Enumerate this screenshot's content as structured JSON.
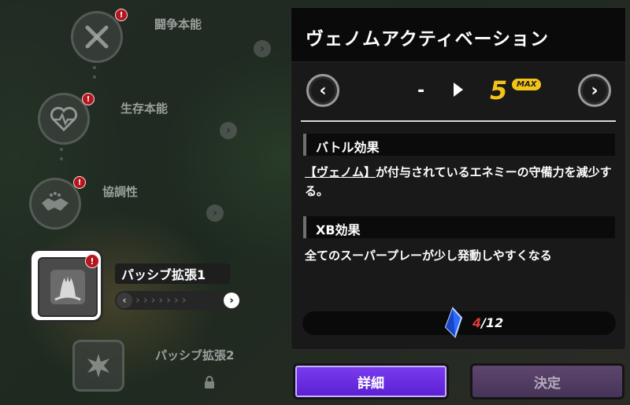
{
  "skill_tree": {
    "nodes": [
      {
        "label": "闘争本能",
        "icon": "crossed-swords-icon",
        "alert": "!"
      },
      {
        "label": "生存本能",
        "icon": "heart-pulse-icon",
        "alert": "!"
      },
      {
        "label": "協調性",
        "icon": "handshake-icon",
        "alert": "!"
      },
      {
        "label": "パッシブ拡張2",
        "icon": "burst-icon"
      }
    ],
    "selected": {
      "label": "パッシブ拡張1",
      "icon": "venom-claw-icon",
      "alert": "!",
      "progress": 0
    }
  },
  "panel": {
    "title": "ヴェノムアクティベーション",
    "level": {
      "current": "-",
      "next": "5",
      "max_badge": "MAX"
    },
    "battle_effect": {
      "heading": "バトル効果",
      "text_prefix": "【ヴェノム】",
      "text_rest": "が付与されているエネミーの守備力を減少する。"
    },
    "xb_effect": {
      "heading": "XB効果",
      "text": "全てのスーパープレーが少し発動しやすくなる"
    },
    "cost": {
      "icon": "blue-crystal-icon",
      "have": "4",
      "need": "/12",
      "accent_color": "#e23a3a"
    }
  },
  "buttons": {
    "detail": "詳細",
    "decide": "決定"
  },
  "colors": {
    "level_accent": "#f2c418",
    "detail_button": "#6a2ee8",
    "decide_button": "#523c63"
  }
}
